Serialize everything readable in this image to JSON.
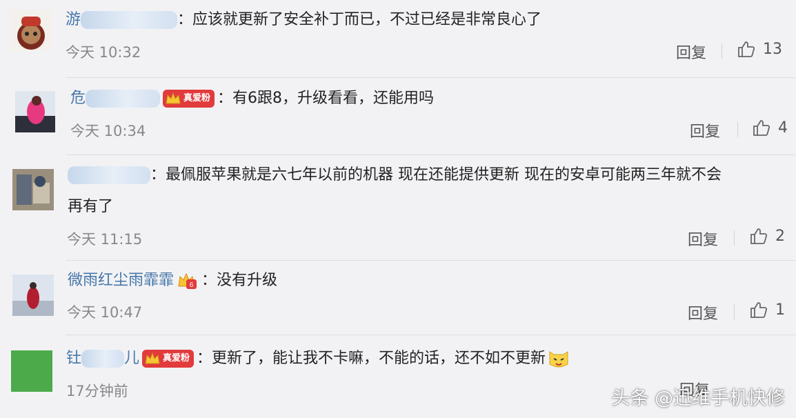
{
  "ui": {
    "reply_label": "回复"
  },
  "comments": [
    {
      "name_visible": "游",
      "text": "：应该就更新了安全补丁而已，不过已经是非常良心了",
      "time": "今天 10:32",
      "likes": "13"
    },
    {
      "name_visible": "危",
      "badge": "真爱粉",
      "text": "：有6跟8，升级看看，还能用吗",
      "time": "今天 10:34",
      "likes": "4"
    },
    {
      "name_visible": "",
      "text_line1": "：最佩服苹果就是六七年以前的机器 现在还能提供更新 现在的安卓可能两三年就不会",
      "text_line2": "再有了",
      "time": "今天 11:15",
      "likes": "2"
    },
    {
      "name_visible": "微雨红尘雨霏霏",
      "text": "：没有升级",
      "time": "今天 10:47",
      "likes": "1"
    },
    {
      "name_prefix": "钍",
      "name_suffix": "儿",
      "badge": "真爱粉",
      "text": "：更新了，能让我不卡嘛，不能的话，还不如不更新",
      "time": "17分钟前"
    }
  ],
  "watermark": "头条 @迅维手机快修"
}
